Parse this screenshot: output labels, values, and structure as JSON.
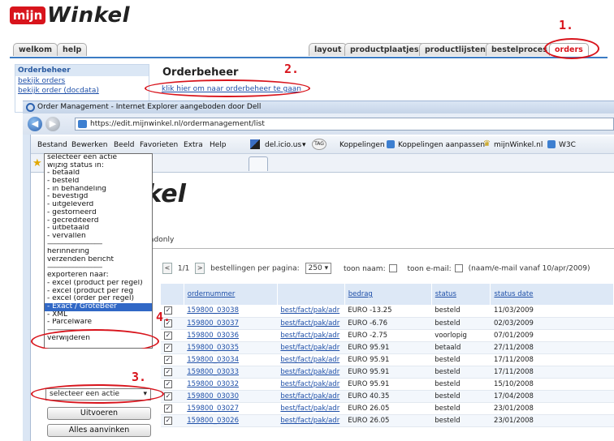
{
  "logo": {
    "badge": "mijn",
    "word": "Winkel"
  },
  "nav_tabs": {
    "left": [
      "welkom",
      "help"
    ],
    "right": [
      "layout",
      "productplaatjes",
      "productlijsten",
      "bestelproces",
      "orders"
    ]
  },
  "sidebar": {
    "title": "Orderbeheer",
    "links": [
      "bekijk orders",
      "bekijk order (docdata)"
    ]
  },
  "page": {
    "title": "Orderbeheer",
    "link": "klik hier om naar orderbeheer te gaan"
  },
  "annotations": {
    "step1": "1.",
    "step2": "2.",
    "step3": "3.",
    "step4": "4."
  },
  "browser": {
    "title": "Order Management - Internet Explorer aangeboden door Dell",
    "url": "https://edit.mijnwinkel.nl/ordermanagement/list",
    "menu": [
      "Bestand",
      "Bewerken",
      "Beeld",
      "Favorieten",
      "Extra",
      "Help"
    ],
    "toolbar": [
      "del.icio.us",
      "TAG",
      "Koppelingen",
      "Koppelingen aanpassen",
      "mijnWinkel.nl",
      "W3C"
    ]
  },
  "inner": {
    "logo_word": "nkel",
    "tab_label": "loadonly",
    "pager": {
      "pages": "1/1",
      "per_page_label": "bestellingen per pagina:",
      "per_page_value": "250",
      "show_name": "toon naam:",
      "show_email": "toon e-mail:",
      "note": "(naam/e-mail vanaf 10/apr/2009)"
    }
  },
  "table": {
    "headers": [
      "ordernummer",
      "",
      "bedrag",
      "status",
      "status date"
    ],
    "rows": [
      {
        "order": "159800_03038",
        "links": "best/fact/pak/adr",
        "amount": "EURO -13.25",
        "status": "besteld",
        "date": "11/03/2009"
      },
      {
        "order": "159800_03037",
        "links": "best/fact/pak/adr",
        "amount": "EURO -6.76",
        "status": "besteld",
        "date": "02/03/2009"
      },
      {
        "order": "159800_03036",
        "links": "best/fact/pak/adr",
        "amount": "EURO -2.75",
        "status": "voorlopig",
        "date": "07/01/2009"
      },
      {
        "order": "159800_03035",
        "links": "best/fact/pak/adr",
        "amount": "EURO 95.91",
        "status": "betaald",
        "date": "27/11/2008"
      },
      {
        "order": "159800_03034",
        "links": "best/fact/pak/adr",
        "amount": "EURO 95.91",
        "status": "besteld",
        "date": "17/11/2008"
      },
      {
        "order": "159800_03033",
        "links": "best/fact/pak/adr",
        "amount": "EURO 95.91",
        "status": "besteld",
        "date": "17/11/2008"
      },
      {
        "order": "159800_03032",
        "links": "best/fact/pak/adr",
        "amount": "EURO 95.91",
        "status": "besteld",
        "date": "15/10/2008"
      },
      {
        "order": "159800_03030",
        "links": "best/fact/pak/adr",
        "amount": "EURO 40.35",
        "status": "besteld",
        "date": "17/04/2008"
      },
      {
        "order": "159800_03027",
        "links": "best/fact/pak/adr",
        "amount": "EURO 26.05",
        "status": "besteld",
        "date": "23/01/2008"
      },
      {
        "order": "159800_03026",
        "links": "best/fact/pak/adr",
        "amount": "EURO 26.05",
        "status": "besteld",
        "date": "23/01/2008"
      }
    ]
  },
  "dropdown": {
    "items": [
      "selecteer een actie",
      "wijzig status in:",
      "- betaald",
      "- besteld",
      "- in behandeling",
      "- bevestigd",
      "- uitgeleverd",
      "- gestorneerd",
      "- gecrediteerd",
      "- uitbetaald",
      "- vervallen",
      "------------------------------",
      "herinnering",
      "verzenden bericht",
      "------------------------------",
      "exporteren naar:",
      "- excel (product per regel)",
      "- excel (product per reg",
      "- excel (order per regel)",
      "- Exact / GroteBeer",
      "- XML",
      "- Parcelware",
      "------------------------------",
      "verwijderen"
    ],
    "selected_value": "selecteer een actie",
    "execute_button": "Uitvoeren",
    "check_all_button": "Alles aanvinken"
  },
  "colors": {
    "accent_red": "#d8141c",
    "link_blue": "#1e4fa8",
    "highlight": "#3168c6"
  }
}
